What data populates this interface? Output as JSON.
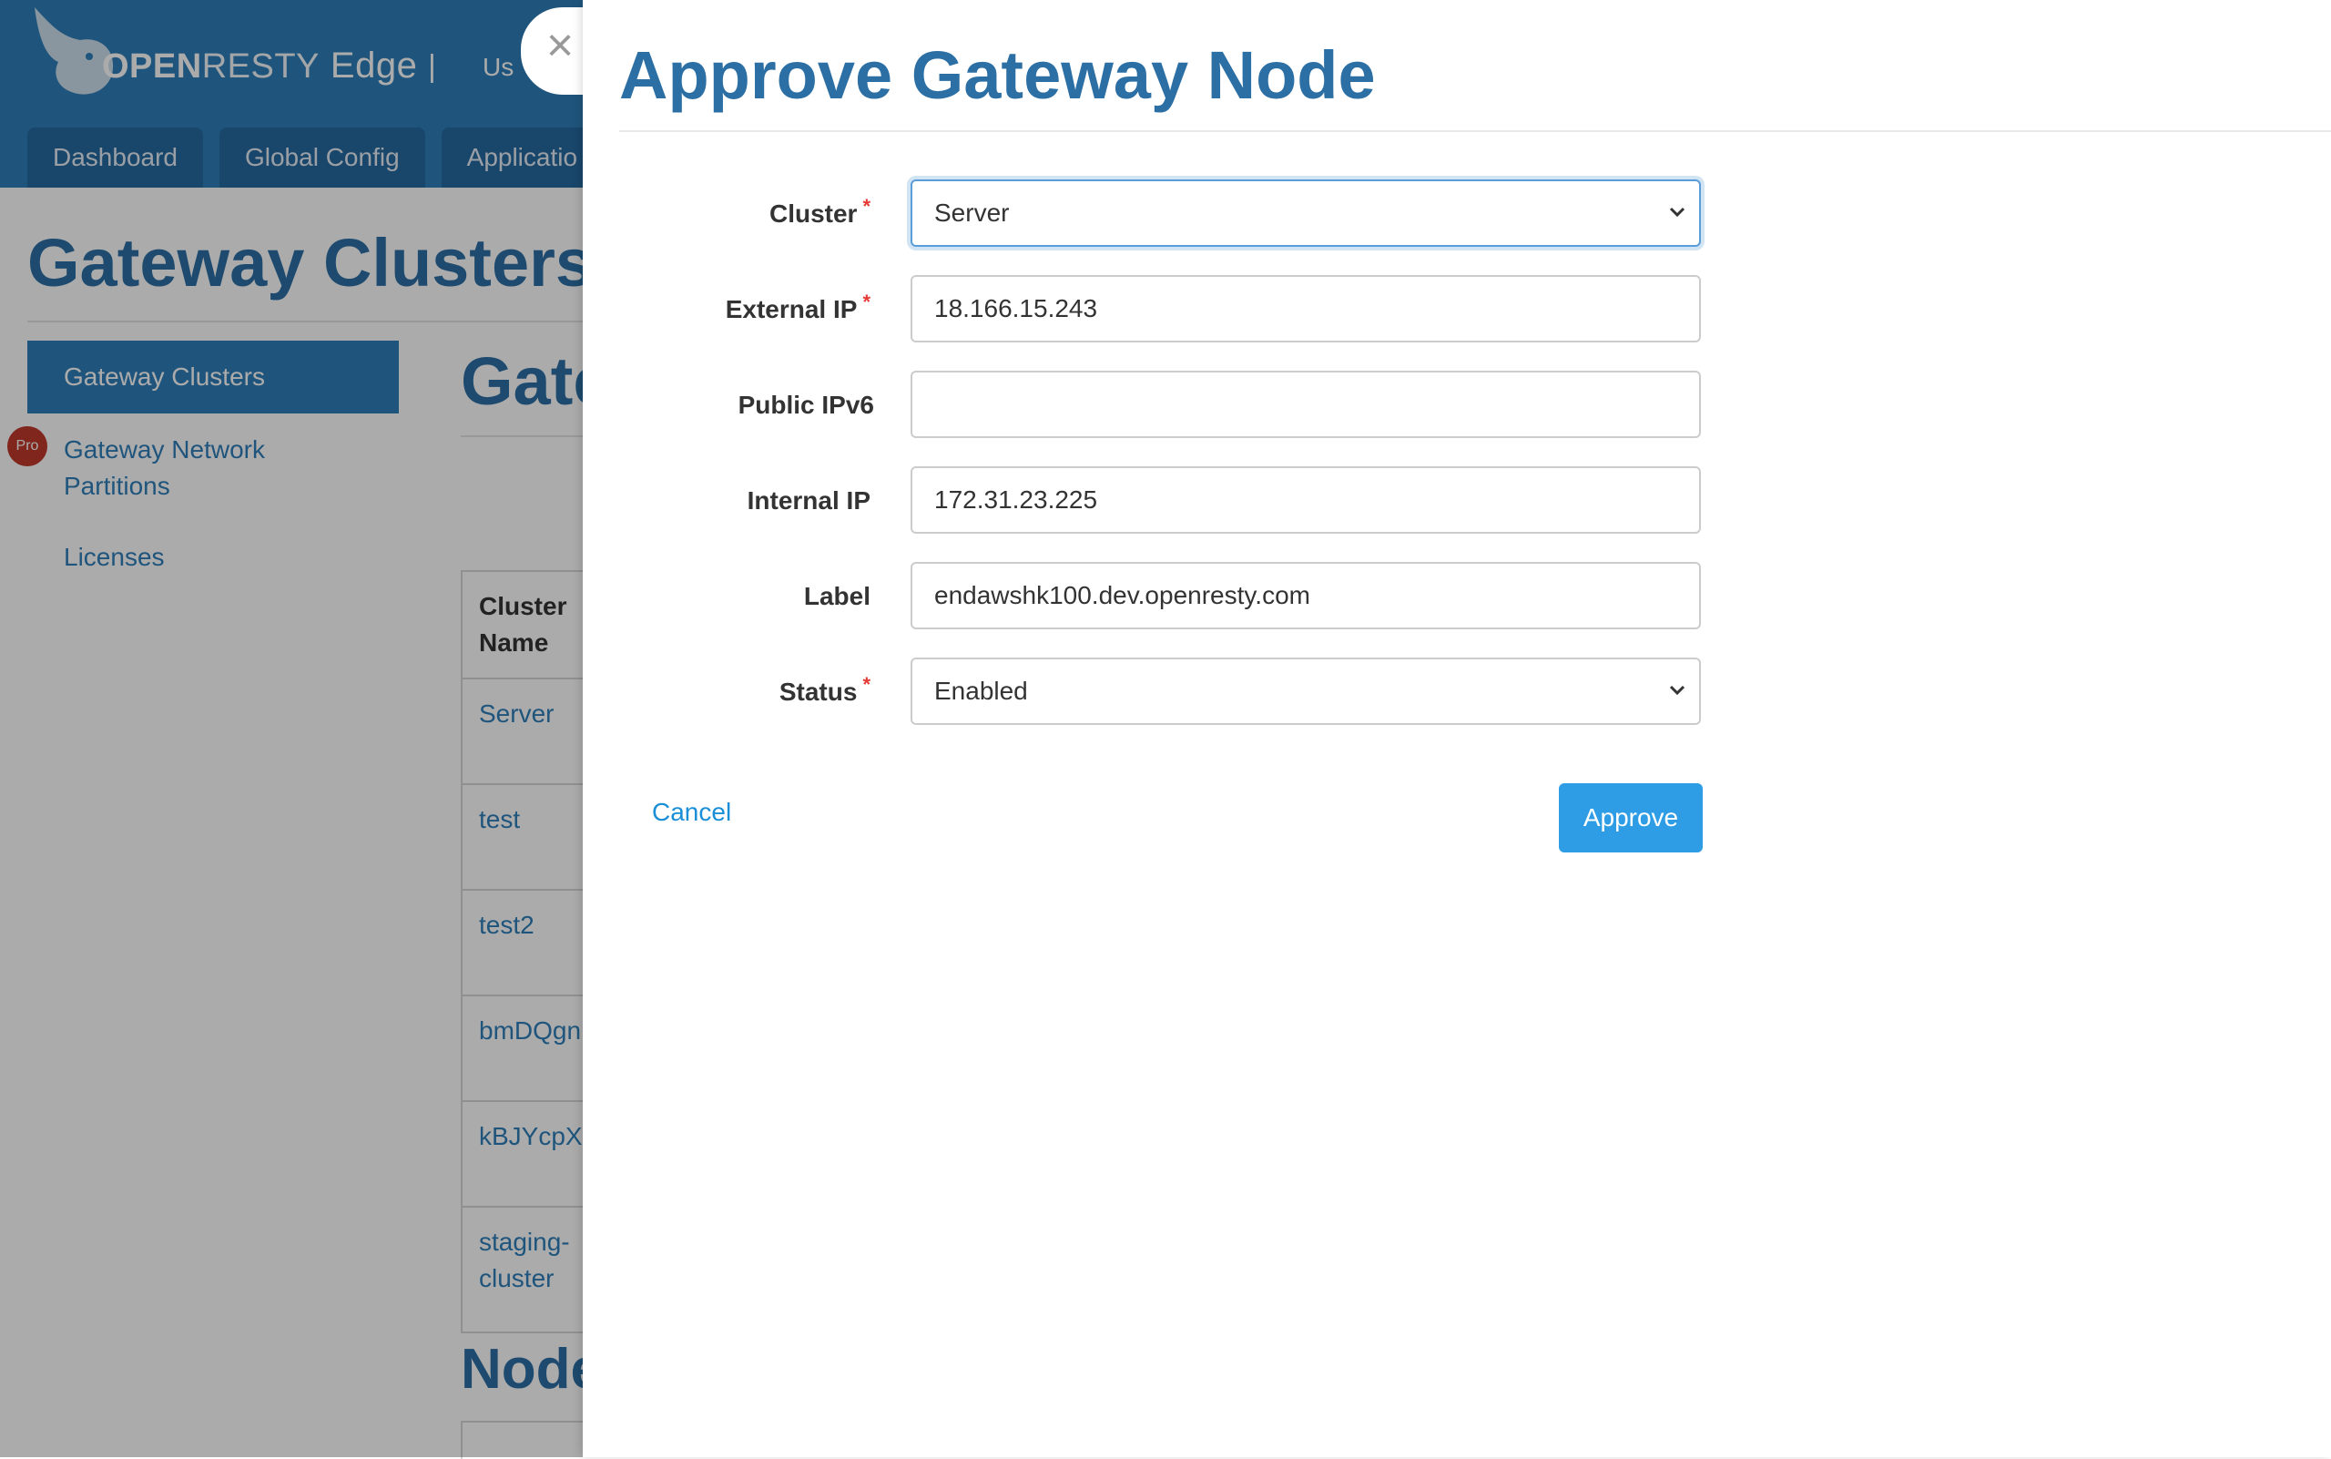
{
  "header": {
    "brand_open": "OPEN",
    "brand_resty": "RESTY",
    "brand_edge": "Edge",
    "separator": "|",
    "user_partial": "Us"
  },
  "nav": {
    "tabs": [
      {
        "label": "Dashboard"
      },
      {
        "label": "Global Config"
      },
      {
        "label": "Applicatio"
      }
    ]
  },
  "page": {
    "title": "Gateway Clusters",
    "content_title_partial": "Gate",
    "nodes_title_partial": "Node"
  },
  "sidebar": {
    "items": [
      {
        "label": "Gateway Clusters",
        "active": true
      },
      {
        "label": "Gateway Network Partitions",
        "badge": "Pro"
      },
      {
        "label": "Licenses"
      }
    ]
  },
  "cluster_table": {
    "header": "Cluster Name",
    "rows": [
      "Server",
      "test",
      "test2",
      "bmDQgn",
      "kBJYcpX",
      "staging-cluster"
    ]
  },
  "drawer": {
    "title": "Approve Gateway Node",
    "close_symbol": "×",
    "fields": {
      "cluster": {
        "label": "Cluster",
        "required": true,
        "value": "Server"
      },
      "external_ip": {
        "label": "External IP",
        "required": true,
        "value": "18.166.15.243"
      },
      "public_ipv6": {
        "label": "Public IPv6",
        "required": false,
        "value": ""
      },
      "internal_ip": {
        "label": "Internal IP",
        "required": false,
        "value": "172.31.23.225"
      },
      "label": {
        "label": "Label",
        "required": false,
        "value": "endawshk100.dev.openresty.com"
      },
      "status": {
        "label": "Status",
        "required": true,
        "value": "Enabled"
      }
    },
    "required_marker": "*",
    "cancel_label": "Cancel",
    "approve_label": "Approve"
  },
  "colors": {
    "brand_blue": "#2f7fba",
    "title_blue": "#2c6fa4",
    "approve_blue": "#2e9de6",
    "link_blue": "#1a8fd8",
    "required_red": "#e53935",
    "pro_badge_red": "#c0392b"
  },
  "icons": {
    "logo": "bird-logo-icon",
    "close": "close-icon",
    "select_chevron": "chevron-down-icon"
  }
}
